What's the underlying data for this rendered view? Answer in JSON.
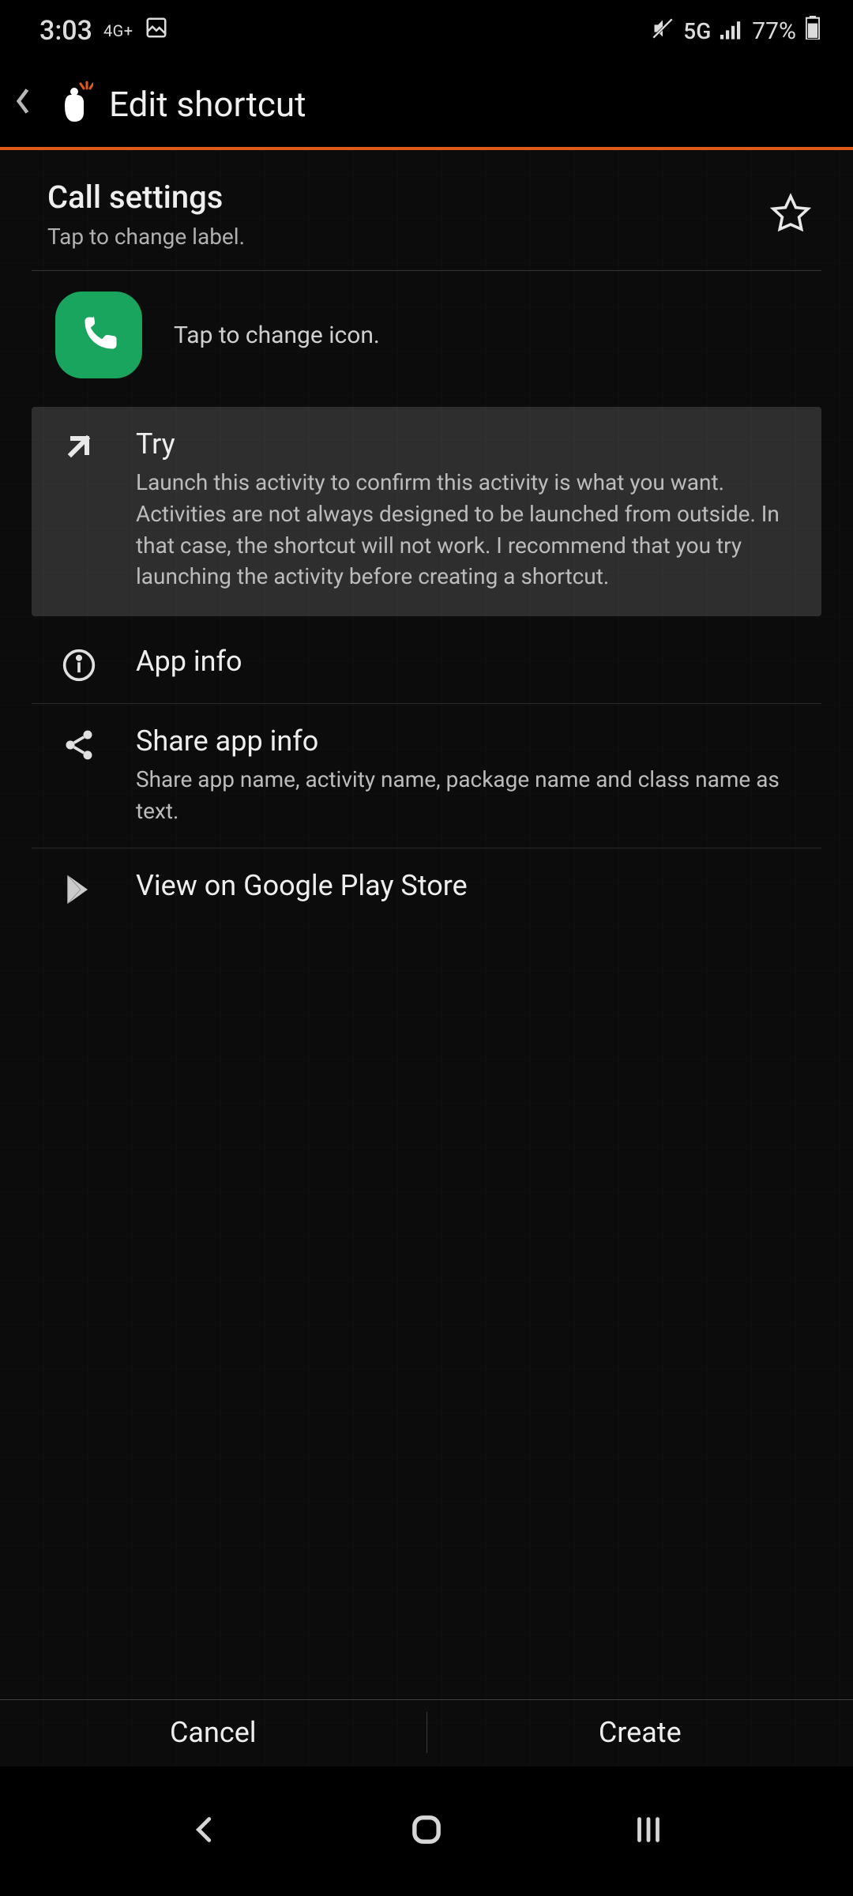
{
  "status_bar": {
    "clock": "3:03",
    "net_small": "4G+",
    "net_label": "5G",
    "battery_pct": "77%"
  },
  "app_bar": {
    "title": "Edit shortcut"
  },
  "label_row": {
    "title": "Call settings",
    "subtitle": "Tap to change label."
  },
  "icon_row": {
    "hint": "Tap to change icon."
  },
  "items": {
    "try": {
      "title": "Try",
      "desc": "Launch this activity to confirm this activity is what you want. Activities are not always designed to be launched from outside. In that case, the shortcut will not work. I recommend that you try launching the activity before creating a shortcut."
    },
    "appinfo": {
      "title": "App info"
    },
    "share": {
      "title": "Share app info",
      "desc": "Share app name, activity name, package name and class name as text."
    },
    "playstore": {
      "title": "View on Google Play Store"
    }
  },
  "actions": {
    "cancel": "Cancel",
    "create": "Create"
  }
}
